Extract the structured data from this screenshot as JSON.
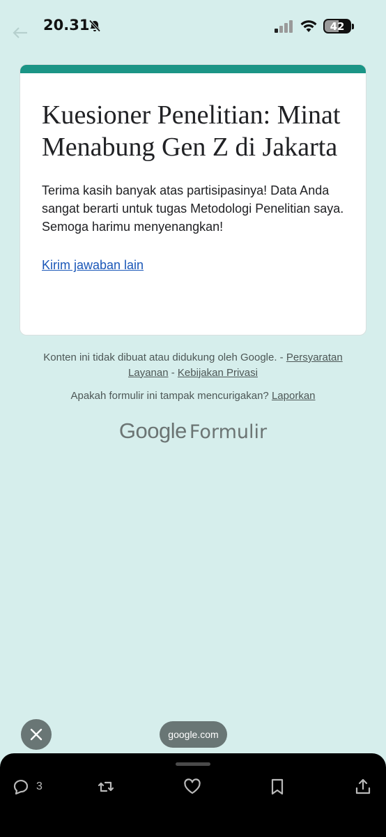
{
  "status_bar": {
    "time": "20.31",
    "battery": "42"
  },
  "form": {
    "title": "Kuesioner Penelitian: Minat Menabung Gen Z di Jakarta",
    "message": "Terima kasih banyak atas partisipasinya! Data Anda sangat berarti untuk tugas Metodologi Penelitian saya. Semoga harimu menyenangkan!",
    "another_response_link": "Kirim jawaban lain"
  },
  "footer": {
    "disclaimer": "Konten ini tidak dibuat atau didukung oleh Google. - ",
    "terms_link": "Persyaratan Layanan",
    "separator": " - ",
    "privacy_link": "Kebijakan Privasi",
    "report_question": "Apakah formulir ini tampak mencurigakan? ",
    "report_link": "Laporkan"
  },
  "logo": {
    "brand": "Google",
    "product": "Formulir"
  },
  "browser": {
    "url": "google.com"
  },
  "bottom_actions": {
    "reply_count": "3"
  },
  "colors": {
    "background": "#d6eeec",
    "accent": "#1b9586",
    "link": "#1a57b8"
  }
}
